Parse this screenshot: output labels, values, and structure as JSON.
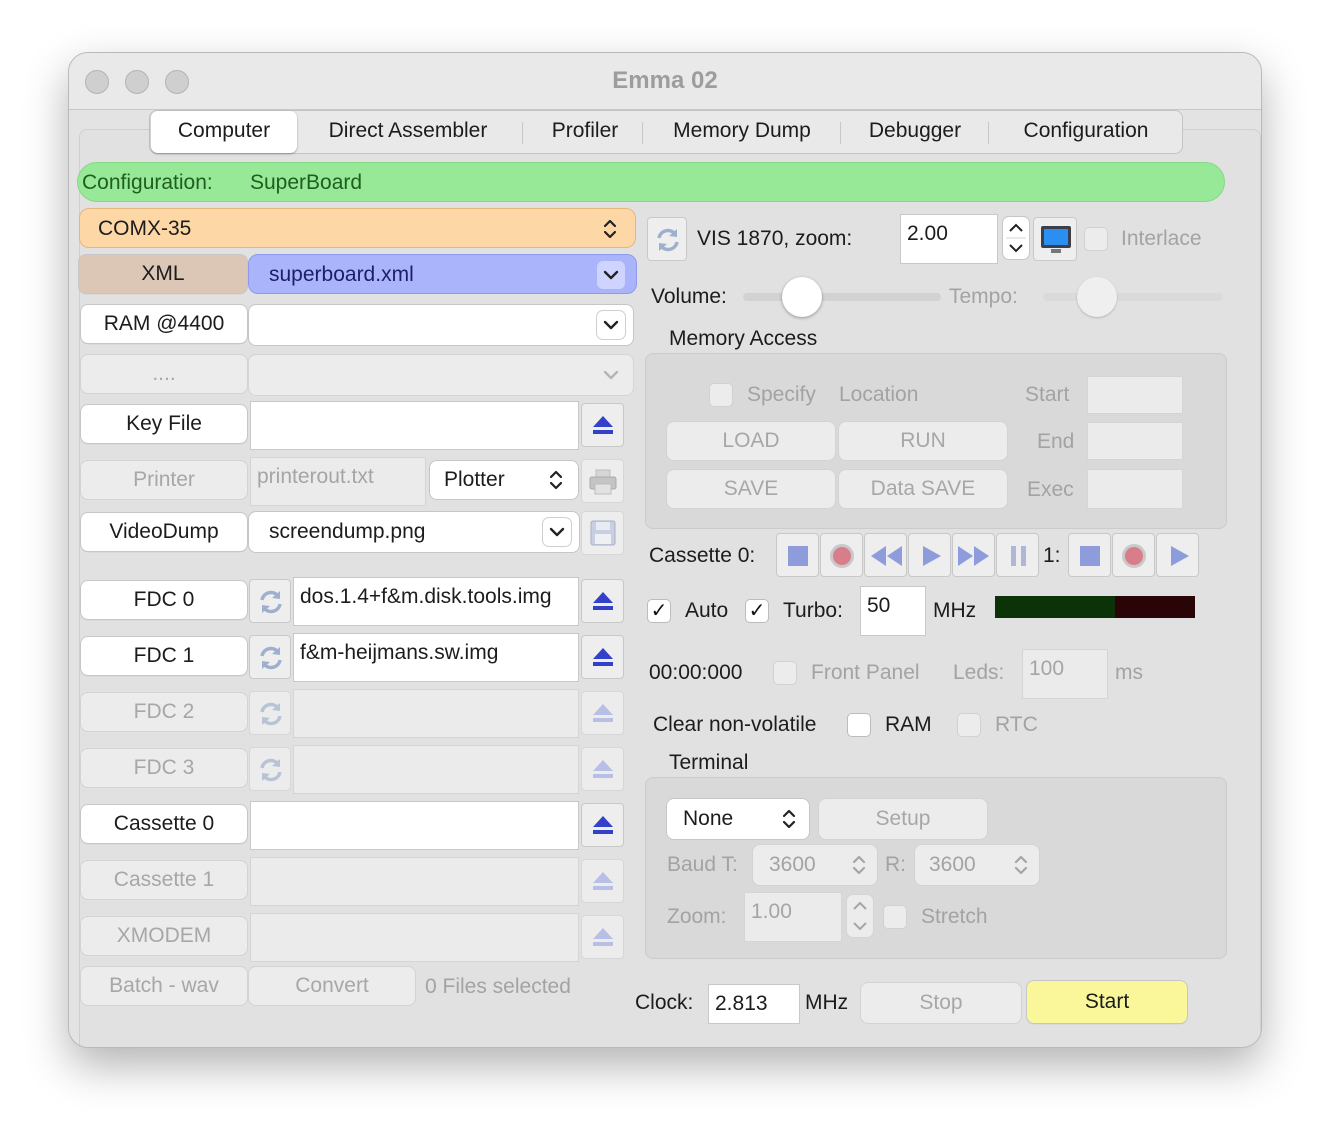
{
  "window": {
    "title": "Emma 02"
  },
  "tabs": [
    "Computer",
    "Direct Assembler",
    "Profiler",
    "Memory Dump",
    "Debugger",
    "Configuration"
  ],
  "config_bar": {
    "label": "Configuration:",
    "value": "SuperBoard",
    "color": "#97e897"
  },
  "left": {
    "computer": "COMX-35",
    "xml_label": "XML",
    "xml_file": "superboard.xml",
    "ram_label": "RAM @4400",
    "ram_value": "",
    "dots_label": "....",
    "keyfile_label": "Key File",
    "keyfile_value": "",
    "printer_label": "Printer",
    "printer_file": "printerout.txt",
    "printer_mode": "Plotter",
    "videodump_label": "VideoDump",
    "videodump_file": "screendump.png",
    "fdc0_label": "FDC 0",
    "fdc0_file": "dos.1.4+f&m.disk.tools.img",
    "fdc1_label": "FDC 1",
    "fdc1_file": "f&m-heijmans.sw.img",
    "fdc2_label": "FDC 2",
    "fdc3_label": "FDC 3",
    "cassette0_label": "Cassette 0",
    "cassette1_label": "Cassette 1",
    "xmodem_label": "XMODEM",
    "batch_label": "Batch - wav",
    "convert_label": "Convert",
    "files_selected": "0 Files selected"
  },
  "video": {
    "label": "VIS 1870, zoom:",
    "zoom": "2.00",
    "interlace": "Interlace"
  },
  "sound": {
    "volume_label": "Volume:",
    "volume_level": 0.3,
    "tempo_label": "Tempo:",
    "tempo_level": 0.3
  },
  "memory": {
    "title": "Memory Access",
    "specify": "Specify",
    "location": "Location",
    "start": "Start",
    "end": "End",
    "exec": "Exec",
    "load": "LOAD",
    "run": "RUN",
    "save": "SAVE",
    "data_save": "Data SAVE"
  },
  "cassette": {
    "label": "Cassette 0:",
    "label1": "1:"
  },
  "turbo": {
    "auto": "Auto",
    "turbo": "Turbo:",
    "value": "50",
    "unit": "MHz"
  },
  "timer": {
    "time": "00:00:000",
    "front_panel": "Front Panel",
    "leds": "Leds:",
    "leds_value": "100",
    "ms": "ms"
  },
  "clear": {
    "label": "Clear non-volatile",
    "ram": "RAM",
    "rtc": "RTC"
  },
  "terminal": {
    "title": "Terminal",
    "type": "None",
    "setup": "Setup",
    "baud_t": "Baud T:",
    "baud_t_value": "3600",
    "baud_r": "R:",
    "baud_r_value": "3600",
    "zoom": "Zoom:",
    "zoom_value": "1.00",
    "stretch": "Stretch"
  },
  "bottom": {
    "clock_label": "Clock:",
    "clock_value": "2.813",
    "mhz": "MHz",
    "stop": "Stop",
    "start": "Start",
    "start_color": "#f9f79a"
  }
}
